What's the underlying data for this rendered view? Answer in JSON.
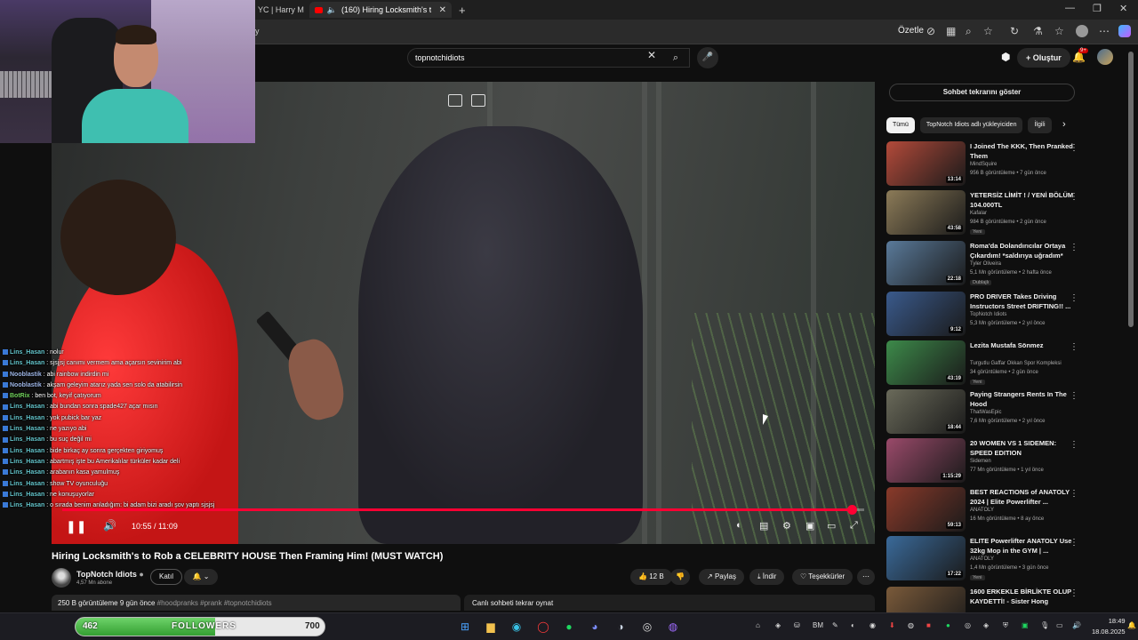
{
  "browser": {
    "tabs": [
      {
        "label": "YC | Harry M",
        "active": false
      },
      {
        "label": "(160) Hiring Locksmith's to R",
        "active": true
      }
    ],
    "new_tab": "+",
    "ozetle": "Özetle",
    "address_fragment": "y"
  },
  "header": {
    "search_value": "topnotchidiots",
    "create_label": "Oluştur",
    "notif_count": "9+"
  },
  "player": {
    "time": "10:55 / 11:09",
    "progress": 0.985
  },
  "video": {
    "title": "Hiring Locksmith's to Rob a CELEBRITY HOUSE Then Framing Him! (MUST WATCH)",
    "channel": "TopNotch Idiots",
    "subs": "4,57 Mn abone",
    "join": "Katıl",
    "likes": "12 B",
    "share": "Paylaş",
    "download": "İndir",
    "thanks": "Teşekkürler",
    "more": "⋯",
    "views_date": "250 B görüntüleme  9 gün önce",
    "tags": "#hoodpranks #prank #topnotchidiots",
    "replay_chat": "Canlı sohbeti tekrar oynat"
  },
  "chat": [
    {
      "user": "Lins_Hasan",
      "msg": "nolur",
      "cls": ""
    },
    {
      "user": "Lins_Hasan",
      "msg": "sjsjjsj canımı vermem ama açarsın sevinirim abi",
      "cls": ""
    },
    {
      "user": "Nooblastik",
      "msg": "abi rainbow indirdin mi",
      "cls": "nb"
    },
    {
      "user": "Nooblastik",
      "msg": "akşam geleyim atarız yada sen solo da atabilirsin",
      "cls": "nb"
    },
    {
      "user": "BotRix",
      "msg": "ben bot, keyif çatıyorum",
      "cls": "bt"
    },
    {
      "user": "Lins_Hasan",
      "msg": "abi bundan sonra spade427 açar mısın",
      "cls": ""
    },
    {
      "user": "Lins_Hasan",
      "msg": "yok pubick bar yaz",
      "cls": ""
    },
    {
      "user": "Lins_Hasan",
      "msg": "ne yazıyo abi",
      "cls": ""
    },
    {
      "user": "Lins_Hasan",
      "msg": "bu suç değil mi",
      "cls": ""
    },
    {
      "user": "Lins_Hasan",
      "msg": "bide birkaç ay sonra gerçekten giriyomuş",
      "cls": ""
    },
    {
      "user": "Lins_Hasan",
      "msg": "abartmış işte bu Amerikalılar türküler kadar deli",
      "cls": ""
    },
    {
      "user": "Lins_Hasan",
      "msg": "arabanın kasa yamulmuş",
      "cls": ""
    },
    {
      "user": "Lins_Hasan",
      "msg": "show TV oyunculuğu",
      "cls": ""
    },
    {
      "user": "Lins_Hasan",
      "msg": "ne konuşuyorlar",
      "cls": ""
    },
    {
      "user": "Lins_Hasan",
      "msg": "o sırada benim anladığım: bi adam bizi aradı şov yaptı sjsjsj",
      "cls": ""
    }
  ],
  "sidebar": {
    "chat_button": "Sohbet tekrarını göster",
    "chips": [
      "Tümü",
      "TopNotch Idiots adlı yükleyiciden",
      "İlgili"
    ],
    "recs": [
      {
        "title": "I Joined The KKK, Then Pranked Them",
        "channel": "MindSquire",
        "meta": "956 B görüntüleme • 7 gün önce",
        "badge": "",
        "dur": "13:14",
        "color": "#b34a3a"
      },
      {
        "title": "YETERSİZ LİMİT ! / YENİ BÖLÜM 104.000TL",
        "channel": "Kafalar",
        "meta": "984 B görüntüleme • 2 gün önce",
        "badge": "Yeni",
        "dur": "43:58",
        "color": "#8c7b58"
      },
      {
        "title": "Roma'da Dolandırıcılar Ortaya Çıkardım! *saldırıya uğradım*",
        "channel": "Tyler Oliveira",
        "meta": "5,1 Mn görüntüleme • 2 hafta önce",
        "badge": "Dublajlı",
        "dur": "22:18",
        "color": "#5a7a9a"
      },
      {
        "title": "PRO DRIVER Takes Driving Instructors Street DRIFTING!! ...",
        "channel": "TopNotch Idiots",
        "meta": "5,3 Mn görüntüleme • 2 yıl önce",
        "badge": "",
        "dur": "9:12",
        "color": "#3a5a8c"
      },
      {
        "title": "Lezita Mustafa Sönmez",
        "channel": "Turgutlu Gaffar Okkan Spor Kompleksi",
        "meta": "34 görüntüleme • 2 gün önce",
        "badge": "Yeni",
        "dur": "43:19",
        "color": "#3d8a4a"
      },
      {
        "title": "Paying Strangers Rents In The Hood",
        "channel": "ThatWasEpic",
        "meta": "7,6 Mn görüntüleme • 2 yıl önce",
        "badge": "",
        "dur": "18:44",
        "color": "#6a6a5a"
      },
      {
        "title": "20 WOMEN VS 1 SIDEMEN: SPEED EDITION",
        "channel": "Sidemen",
        "meta": "77 Mn görüntüleme • 1 yıl önce",
        "badge": "",
        "dur": "1:15:29",
        "color": "#9a4a6a"
      },
      {
        "title": "BEST REACTIONS of ANATOLY 2024 | Elite Powerlifter ...",
        "channel": "ANATOLY",
        "meta": "16 Mn görüntüleme • 8 ay önce",
        "badge": "",
        "dur": "59:13",
        "color": "#8a3a2a"
      },
      {
        "title": "ELITE Powerlifter ANATOLY Use 32kg Mop in the GYM | ...",
        "channel": "ANATOLY",
        "meta": "1,4 Mn görüntüleme • 3 gün önce",
        "badge": "Yeni",
        "dur": "17:22",
        "color": "#3a6a9a"
      },
      {
        "title": "1600 ERKEKLE BİRLİKTE OLUP KAYDETTİ! - Sister Hong",
        "channel": "",
        "meta": "",
        "badge": "",
        "dur": "",
        "color": "#7a5a3a"
      }
    ]
  },
  "taskbar": {
    "followers_left": "462",
    "followers_label": "FOLLOWERS",
    "followers_right": "700",
    "followers_fill": 0.56,
    "tray_lang": "BM",
    "time": "18:49",
    "date": "18.08.2025"
  }
}
